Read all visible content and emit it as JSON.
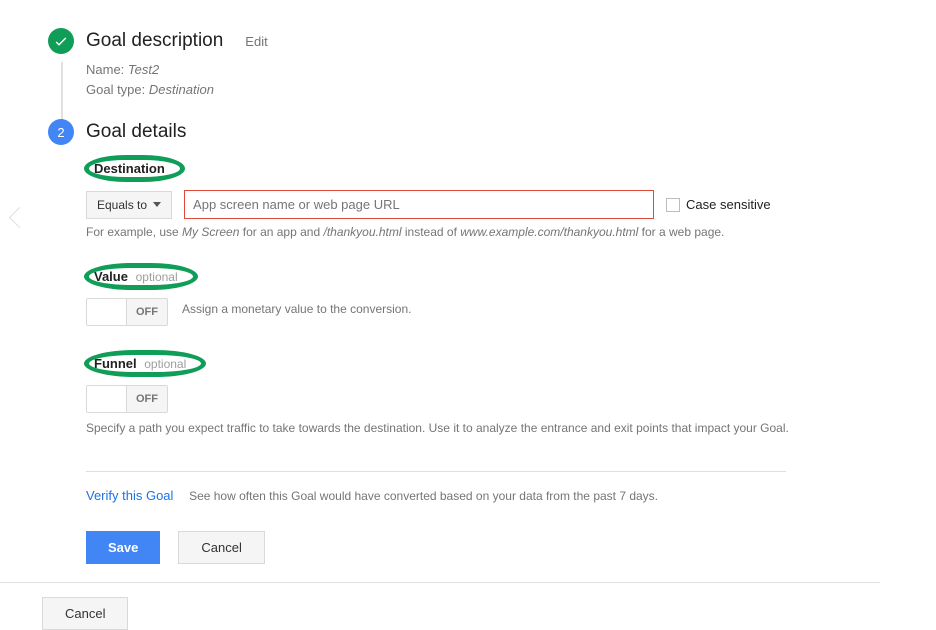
{
  "step1": {
    "title": "Goal description",
    "edit": "Edit",
    "name_label": "Name:",
    "name_value": "Test2",
    "type_label": "Goal type:",
    "type_value": "Destination"
  },
  "step2": {
    "badge": "2",
    "title": "Goal details",
    "destination": {
      "heading": "Destination",
      "dropdown": "Equals to",
      "placeholder": "App screen name or web page URL",
      "case_sensitive": "Case sensitive",
      "help_pre": "For example, use ",
      "help_em1": "My Screen",
      "help_mid1": " for an app and ",
      "help_em2": "/thankyou.html",
      "help_mid2": " instead of ",
      "help_em3": "www.example.com/thankyou.html",
      "help_post": " for a web page."
    },
    "value": {
      "heading": "Value",
      "optional": "optional",
      "toggle_off": "OFF",
      "description": "Assign a monetary value to the conversion."
    },
    "funnel": {
      "heading": "Funnel",
      "optional": "optional",
      "toggle_off": "OFF",
      "description": "Specify a path you expect traffic to take towards the destination. Use it to analyze the entrance and exit points that impact your Goal."
    },
    "verify": {
      "link": "Verify this Goal",
      "description": "See how often this Goal would have converted based on your data from the past 7 days."
    },
    "save": "Save",
    "cancel": "Cancel"
  },
  "page_cancel": "Cancel"
}
